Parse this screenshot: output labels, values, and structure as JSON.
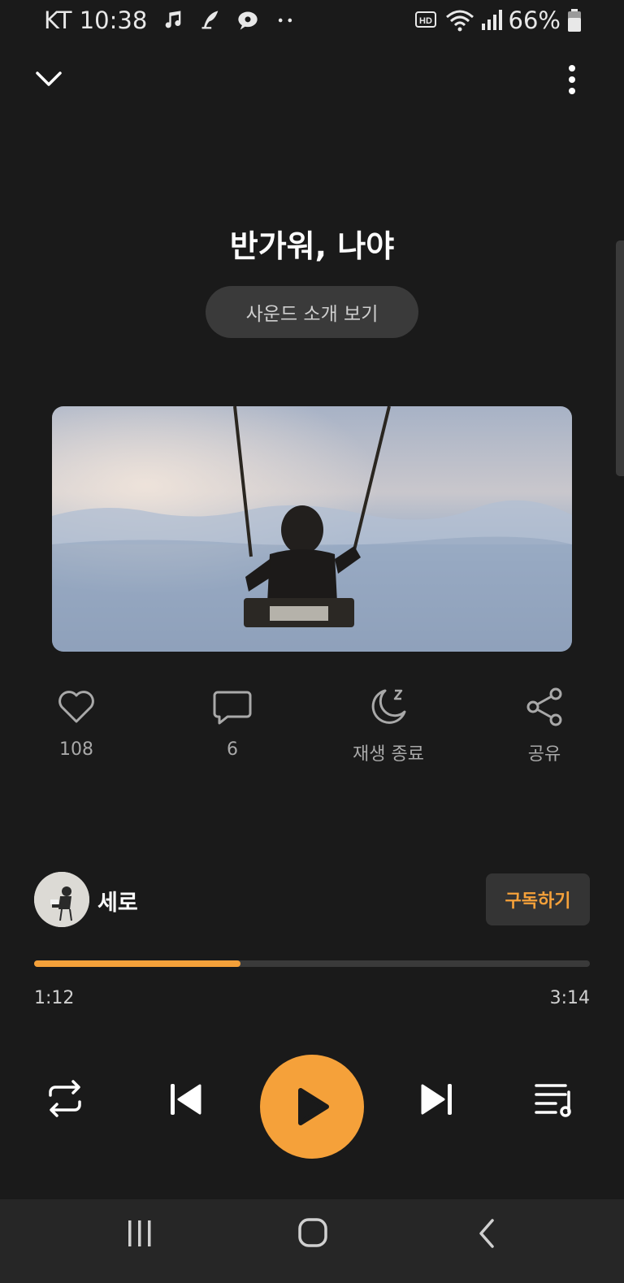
{
  "status_bar": {
    "carrier": "KT",
    "time": "10:38",
    "battery": "66%",
    "hd_badge": "HD",
    "icons": [
      "music-note-icon",
      "quill-icon",
      "chat-bubble-icon",
      "more-dots-icon",
      "hd-voice-icon",
      "wifi-icon",
      "signal-icon",
      "battery-icon"
    ]
  },
  "header": {
    "collapse_icon": "chevron-down-icon",
    "more_icon": "more-vertical-icon"
  },
  "track": {
    "title": "반가워, 나야",
    "intro_button": "사운드 소개 보기"
  },
  "actions": {
    "like_count": "108",
    "comment_count": "6",
    "sleep_timer_label": "재생 종료",
    "share_label": "공유"
  },
  "artist": {
    "name": "세로",
    "subscribe_label": "구독하기"
  },
  "playback": {
    "elapsed": "1:12",
    "duration": "3:14",
    "progress_fraction": 0.371
  },
  "colors": {
    "accent": "#f5a13a",
    "background": "#1a1a1a",
    "navbar": "#262626"
  }
}
